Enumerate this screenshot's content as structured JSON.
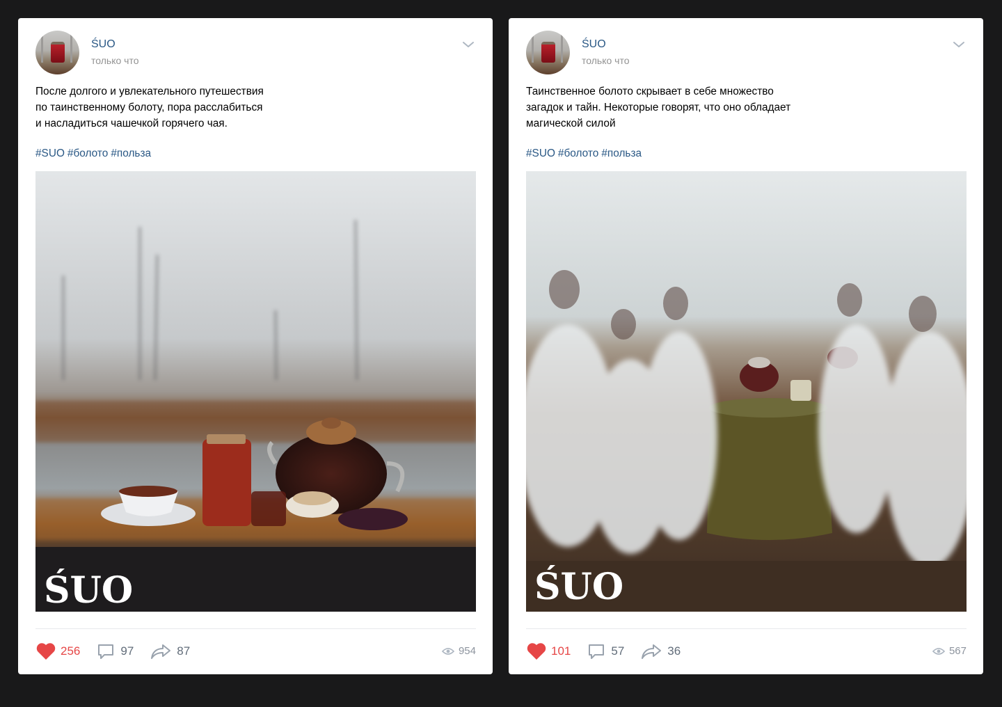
{
  "posts": [
    {
      "author": "ŚUO",
      "time": "только что",
      "text": "После долгого и увлекательного путешествия\nпо таинственному болоту, пора расслабиться\nи насладиться чашечкой горячего чая.",
      "tags": [
        "#SUO",
        "#болото",
        "#польза"
      ],
      "photo_watermark": "ŚUO",
      "likes": "256",
      "comments": "97",
      "shares": "87",
      "views": "954"
    },
    {
      "author": "ŚUO",
      "time": "только что",
      "text": "Таинственное болото скрывает в себе множество\nзагадок и тайн. Некоторые говорят, что оно обладает\nмагической силой",
      "tags": [
        "#SUO",
        "#болото",
        "#польза"
      ],
      "photo_watermark": "ŚUO",
      "likes": "101",
      "comments": "57",
      "shares": "36",
      "views": "567"
    }
  ],
  "icons": {
    "menu": "chevron-down-icon",
    "like": "heart-icon",
    "comment": "comment-icon",
    "share": "share-icon",
    "views": "eye-icon"
  },
  "colors": {
    "background": "#19191a",
    "card": "#ffffff",
    "link": "#2a5885",
    "like": "#e64646",
    "muted": "#939393"
  }
}
